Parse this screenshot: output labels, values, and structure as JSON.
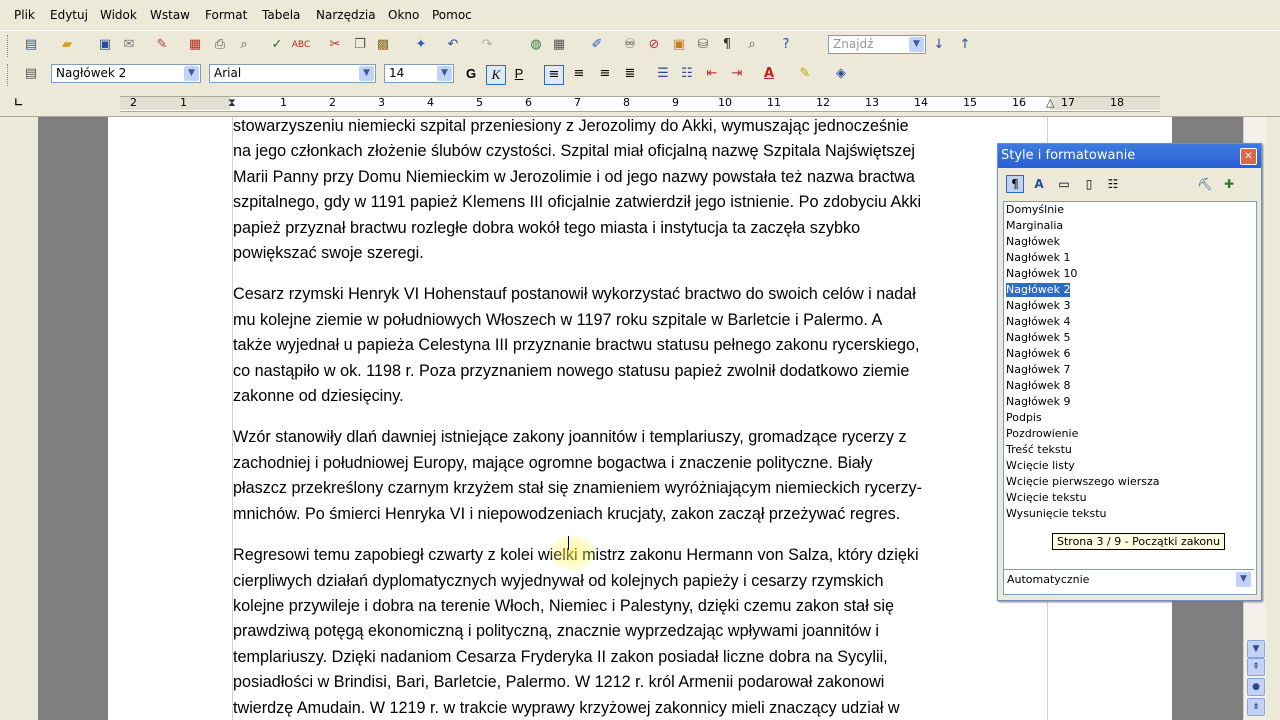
{
  "menu": [
    "Plik",
    "Edytuj",
    "Widok",
    "Wstaw",
    "Format",
    "Tabela",
    "Narzędzia",
    "Okno",
    "Pomoc"
  ],
  "toolbar1": {
    "icons": [
      "new-document-icon",
      "open-icon",
      "save-icon",
      "email-icon",
      "edit-mode-icon",
      "export-pdf-icon",
      "print-icon",
      "print-preview-icon",
      "spellcheck-icon",
      "autospellcheck-icon",
      "cut-icon",
      "copy-icon",
      "paste-icon",
      "format-paintbrush-icon",
      "undo-icon",
      "redo-icon",
      "hyperlink-icon",
      "table-icon",
      "draw-icon",
      "navigator-icon",
      "gallery-icon",
      "data-sources-icon",
      "nonprinting-chars-icon",
      "zoom-icon",
      "help-icon"
    ],
    "find_placeholder": "Znajdź"
  },
  "toolbar2": {
    "style": "Nagłówek 2",
    "font": "Arial",
    "size": "14",
    "bold": "G",
    "italic": "K",
    "underline": "P"
  },
  "ruler": {
    "numbers": [
      "2",
      "1",
      "1",
      "2",
      "3",
      "4",
      "5",
      "6",
      "7",
      "8",
      "9",
      "10",
      "11",
      "12",
      "13",
      "14",
      "15",
      "16",
      "17",
      "18"
    ]
  },
  "document": {
    "paragraphs": [
      "stowarzyszeniu niemiecki szpital przeniesiony z Jerozolimy do Akki, wymuszając jednocześnie\nna jego członkach złożenie ślubów czystości. Szpital miał oficjalną nazwę Szpitala Najświętszej\nMarii Panny przy Domu Niemieckim w Jerozolimie i od jego nazwy powstała też nazwa bractwa\nszpitalnego, gdy w 1191 papież Klemens III oficjalnie zatwierdził jego istnienie. Po zdobyciu Akki\npapież przyznał bractwu rozległe dobra wokół tego miasta i instytucja ta zaczęła szybko\npowiększać swoje szeregi.",
      "Cesarz rzymski Henryk VI Hohenstauf postanowił wykorzystać bractwo do swoich celów i nadał\nmu kolejne ziemie w południowych Włoszech w 1197 roku szpitale w Barletcie i Palermo. A\ntakże wyjednał u papieża Celestyna III przyznanie bractwu statusu pełnego zakonu rycerskiego,\nco nastąpiło w ok. 1198 r. Poza przyznaniem nowego statusu papież zwolnił dodatkowo ziemie\nzakonne od dziesięciny.",
      "Wzór stanowiły dlań dawniej istniejące zakony joannitów i templariuszy, gromadzące rycerzy z\nzachodniej i południowej Europy, mające ogromne bogactwa i znaczenie polityczne. Biały\npłaszcz przekreślony czarnym krzyżem stał się znamieniem wyróżniającym niemieckich rycerzy-\nmnichów. Po śmierci Henryka VI i niepowodzeniach krucjaty, zakon zaczął przeżywać regres.",
      "Regresowi temu zapobiegł czwarty z kolei wielki mistrz zakonu Hermann von Salza, który dzięki\ncierpliwych działań dyplomatycznych wyjednywał od kolejnych papieży i cesarzy rzymskich\nkolejne przywileje i dobra na terenie Włoch, Niemiec i Palestyny, dzięki czemu zakon stał się\nprawdziwą potęgą ekonomiczną i polityczną, znacznie wyprzedzając wpływami joannitów i\ntemplariuszy. Dzięki nadaniom Cesarza Fryderyka II zakon posiadał liczne dobra na Sycylii,\nposiadłości w Brindisi, Bari, Barletcie, Palermo. W 1212 r. król Armenii podarował zakonowi\ntwierdzę Amudain. W 1219 r. w trakcie wyprawy krzyżowej zakonnicy mieli znaczący udział w"
    ]
  },
  "styles_panel": {
    "title": "Style i formatowanie",
    "items": [
      "Domyślnie",
      "Marginalia",
      "Nagłówek",
      "Nagłówek 1",
      "Nagłówek 10",
      "Nagłówek 2",
      "Nagłówek 3",
      "Nagłówek 4",
      "Nagłówek 5",
      "Nagłówek 6",
      "Nagłówek 7",
      "Nagłówek 8",
      "Nagłówek 9",
      "Podpis",
      "Pozdrowienie",
      "Treść tekstu",
      "Wcięcie listy",
      "Wcięcie pierwszego wiersza",
      "Wcięcie tekstu",
      "Wysunięcie tekstu"
    ],
    "selected_index": 5,
    "tooltip": "Strona  3 / 9  - Początki zakonu",
    "filter": "Automatycznie"
  }
}
